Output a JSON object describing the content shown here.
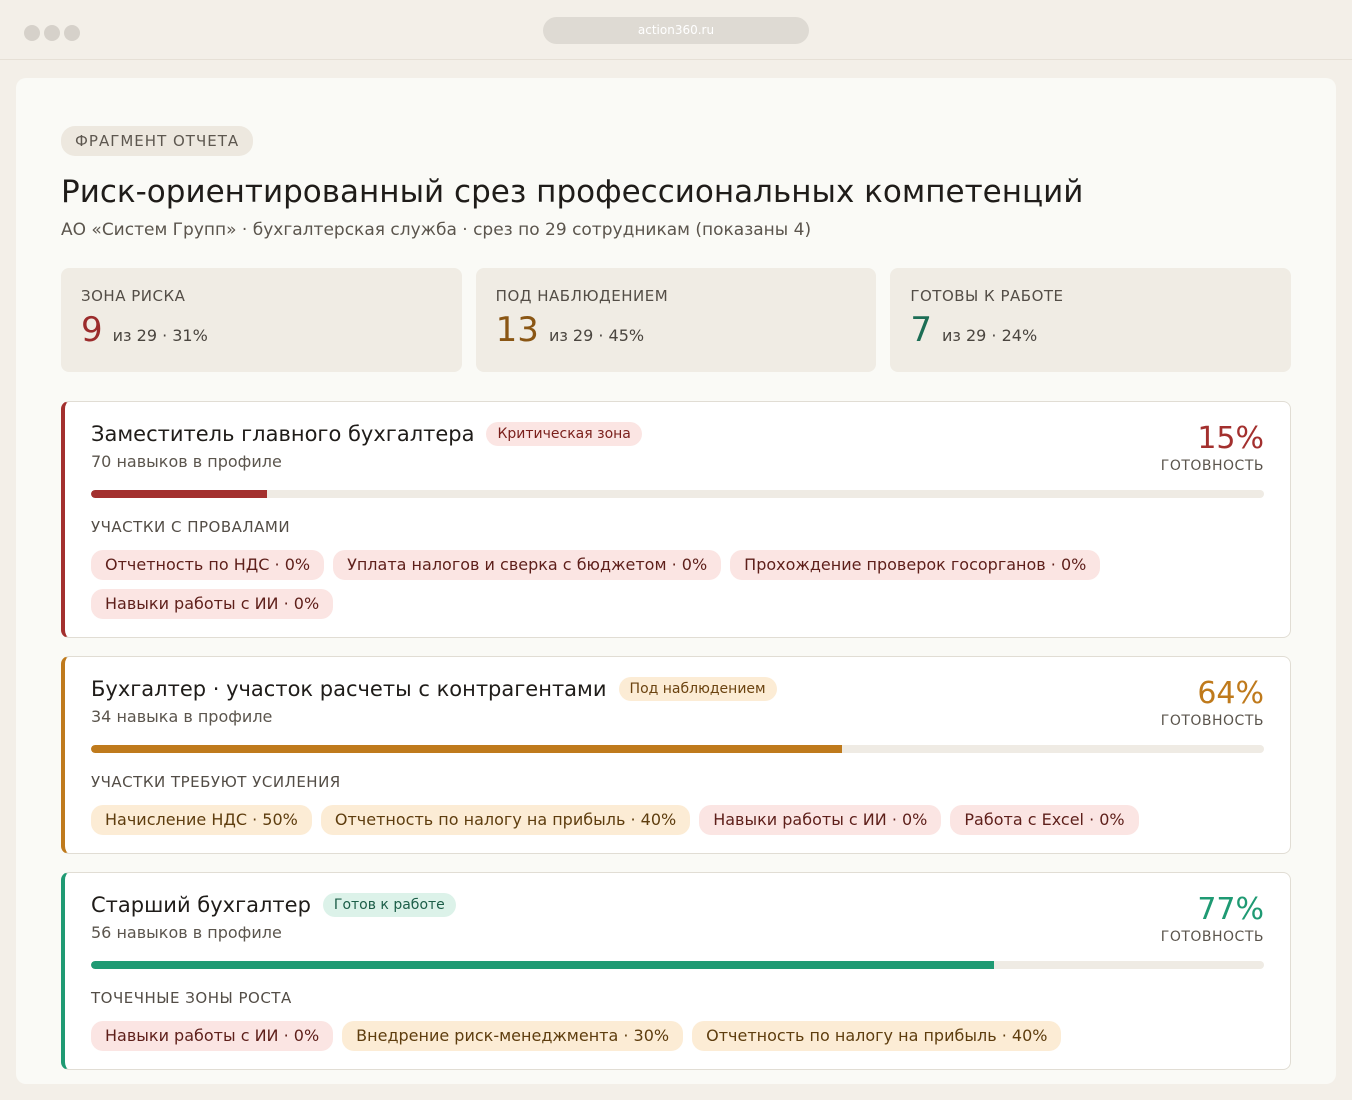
{
  "browser": {
    "url": "action360.ru"
  },
  "report": {
    "badge": "ФРАГМЕНТ ОТЧЕТА",
    "title": "Риск-ориентированный срез профессиональных компетенций",
    "subtitle": "АО «Систем Групп» · бухгалтерская служба · срез по 29 сотрудникам (показаны 4)"
  },
  "stats": [
    {
      "label": "ЗОНА РИСКА",
      "value": "9",
      "extra": "из 29 · 31%",
      "color": "#9b2c2c"
    },
    {
      "label": "ПОД НАБЛЮДЕНИЕМ",
      "value": "13",
      "extra": "из 29 · 45%",
      "color": "#8a5614"
    },
    {
      "label": "ГОТОВЫ К РАБОТЕ",
      "value": "7",
      "extra": "из 29 · 24%",
      "color": "#1c6e55"
    }
  ],
  "cards": [
    {
      "title": "Заместитель главного бухгалтера",
      "status": "Критическая зона",
      "skills": "70 навыков в профиле",
      "readiness": "15%",
      "readiness_label": "ГОТОВНОСТЬ",
      "progress": 15,
      "accent": "#a3302e",
      "pill_bg": "#fbe5e3",
      "pill_fg": "#7a1f1b",
      "section": "УЧАСТКИ С ПРОВАЛАМИ",
      "chips": [
        {
          "text": "Отчетность по НДС · 0%",
          "tone": "red"
        },
        {
          "text": "Уплата налогов и сверка с бюджетом · 0%",
          "tone": "red"
        },
        {
          "text": "Прохождение проверок госорганов · 0%",
          "tone": "red"
        },
        {
          "text": "Навыки работы с ИИ · 0%",
          "tone": "red"
        }
      ]
    },
    {
      "title": "Бухгалтер · участок расчеты с контрагентами",
      "status": "Под наблюдением",
      "skills": "34 навыка в профиле",
      "readiness": "64%",
      "readiness_label": "ГОТОВНОСТЬ",
      "progress": 64,
      "accent": "#bf7a1c",
      "pill_bg": "#fcecd5",
      "pill_fg": "#6b4310",
      "section": "УЧАСТКИ ТРЕБУЮТ УСИЛЕНИЯ",
      "chips": [
        {
          "text": "Начисление НДС · 50%",
          "tone": "amber"
        },
        {
          "text": "Отчетность по налогу на прибыль · 40%",
          "tone": "amber"
        },
        {
          "text": "Навыки работы с ИИ · 0%",
          "tone": "red"
        },
        {
          "text": "Работа с Excel · 0%",
          "tone": "red"
        }
      ]
    },
    {
      "title": "Старший бухгалтер",
      "status": "Готов к работе",
      "skills": "56 навыков в профиле",
      "readiness": "77%",
      "readiness_label": "ГОТОВНОСТЬ",
      "progress": 77,
      "accent": "#1f9a73",
      "pill_bg": "#dcf2e9",
      "pill_fg": "#1c5e48",
      "section": "ТОЧЕЧНЫЕ ЗОНЫ РОСТА",
      "chips": [
        {
          "text": "Навыки работы с ИИ · 0%",
          "tone": "red"
        },
        {
          "text": "Внедрение риск-менеджмента · 30%",
          "tone": "amber"
        },
        {
          "text": "Отчетность по налогу на прибыль · 40%",
          "tone": "amber"
        }
      ]
    }
  ]
}
